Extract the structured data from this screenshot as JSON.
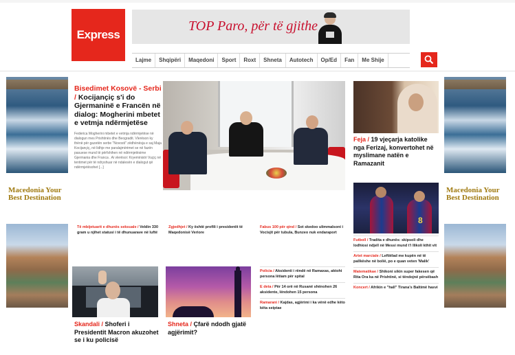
{
  "header": {
    "logo_text": "Express",
    "banner_text": "TOP Paro, për të gjithe",
    "nav": [
      "Lajme",
      "Shqipëri",
      "Maqedoni",
      "Sport",
      "Roxt",
      "Shneta",
      "Autotech",
      "Op/Ed",
      "Fan",
      "Me Shije"
    ],
    "search_icon": "search-icon",
    "accent_color": "#e5271c"
  },
  "side_ads": {
    "left": {
      "title": "Macedonia Your Best Destination"
    },
    "right": {
      "title": "Macedonia Your Best Destination"
    }
  },
  "lead": {
    "category": "Bisedimet Kosovë - Serbi",
    "sep": " / ",
    "title": "Kocijançiç s'i do Gjermaninë e Francën në dialog: Mogherini mbetet e vetmja ndërmjetëse",
    "body": "Federica Mogherini mbetet e vetmja ndërmjetëse në dialogun mes Prishtinës dhe Beogradit. Vlerëson ky thënë për gazetën serbe \"Novosti\" zëdhënësja e saj Maja Kocijançiç, në lidhje me paralajmërimet se në fazën pasuese mund të përfshihen në ndërmjetësime Gjermania dhe Franca . Ai vlerësoi: Kryeministri Vuçiç në tentimet për të ndryshuar në ndalesën e dialogut që ndërmjetësohet [...]"
  },
  "right_col": {
    "story1": {
      "category": "Feja",
      "title": "19 vjeçarja katolike nga Ferizaj, konvertohet në myslimane natën e Ramazanit"
    },
    "list": [
      {
        "category": "Futboll",
        "title": "Tradita e dhunës: skipsoli dhe lodhiosi ndjell në Messi mund t'i Ilikoli kthit vit"
      },
      {
        "category": "Artet marciale",
        "title": "Leftiëlad me kupën në të pallkëshe në bolië, po e quan veten 'Malik'"
      },
      {
        "category": "Matematikae",
        "title": "Shikoni sikin super fakesen që Rita Ora ka në Prishtinë, si tëndojnë përsëbash"
      },
      {
        "category": "Koncert",
        "title": "Afrikin e \"hall\" Tirana's Baltimë hasvi"
      }
    ]
  },
  "mid_row": [
    {
      "category": "Të mbijetuarit e dhunës seksuale",
      "title": "Veldin 330 gram u njihet statusi i të dhunuarave në luftë"
    },
    {
      "category": "Zgjedhjet",
      "title": "Ky është profili i presidentit të Maqedonisë Veriore"
    },
    {
      "category": "Fabus 100 për qind",
      "title": "Sot skedoo ulimmalsoni i Vocisjit për tubula, Bunzeo nuk endaraport"
    }
  ],
  "bottom_cards": [
    {
      "category": "Skandali",
      "title": "Shoferi i Presidentit Macron akuzohet se i ku policisë"
    },
    {
      "category": "Shneta",
      "title": "Çfarë ndodh gjatë agjërimit?"
    }
  ],
  "center_list": [
    {
      "category": "Policia",
      "title": "Aksidenti i rëndë në Ramaxas, aktohi persona lëtiam për spital"
    },
    {
      "category": "E deta",
      "title": "Për 14 orë në Rusanë shënohen 26 aksidente, lëndohen 15 persona"
    },
    {
      "category": "Ramarani",
      "title": "Kajdas, agjërimi i ka vënë edhe këto këta seiptae"
    }
  ]
}
